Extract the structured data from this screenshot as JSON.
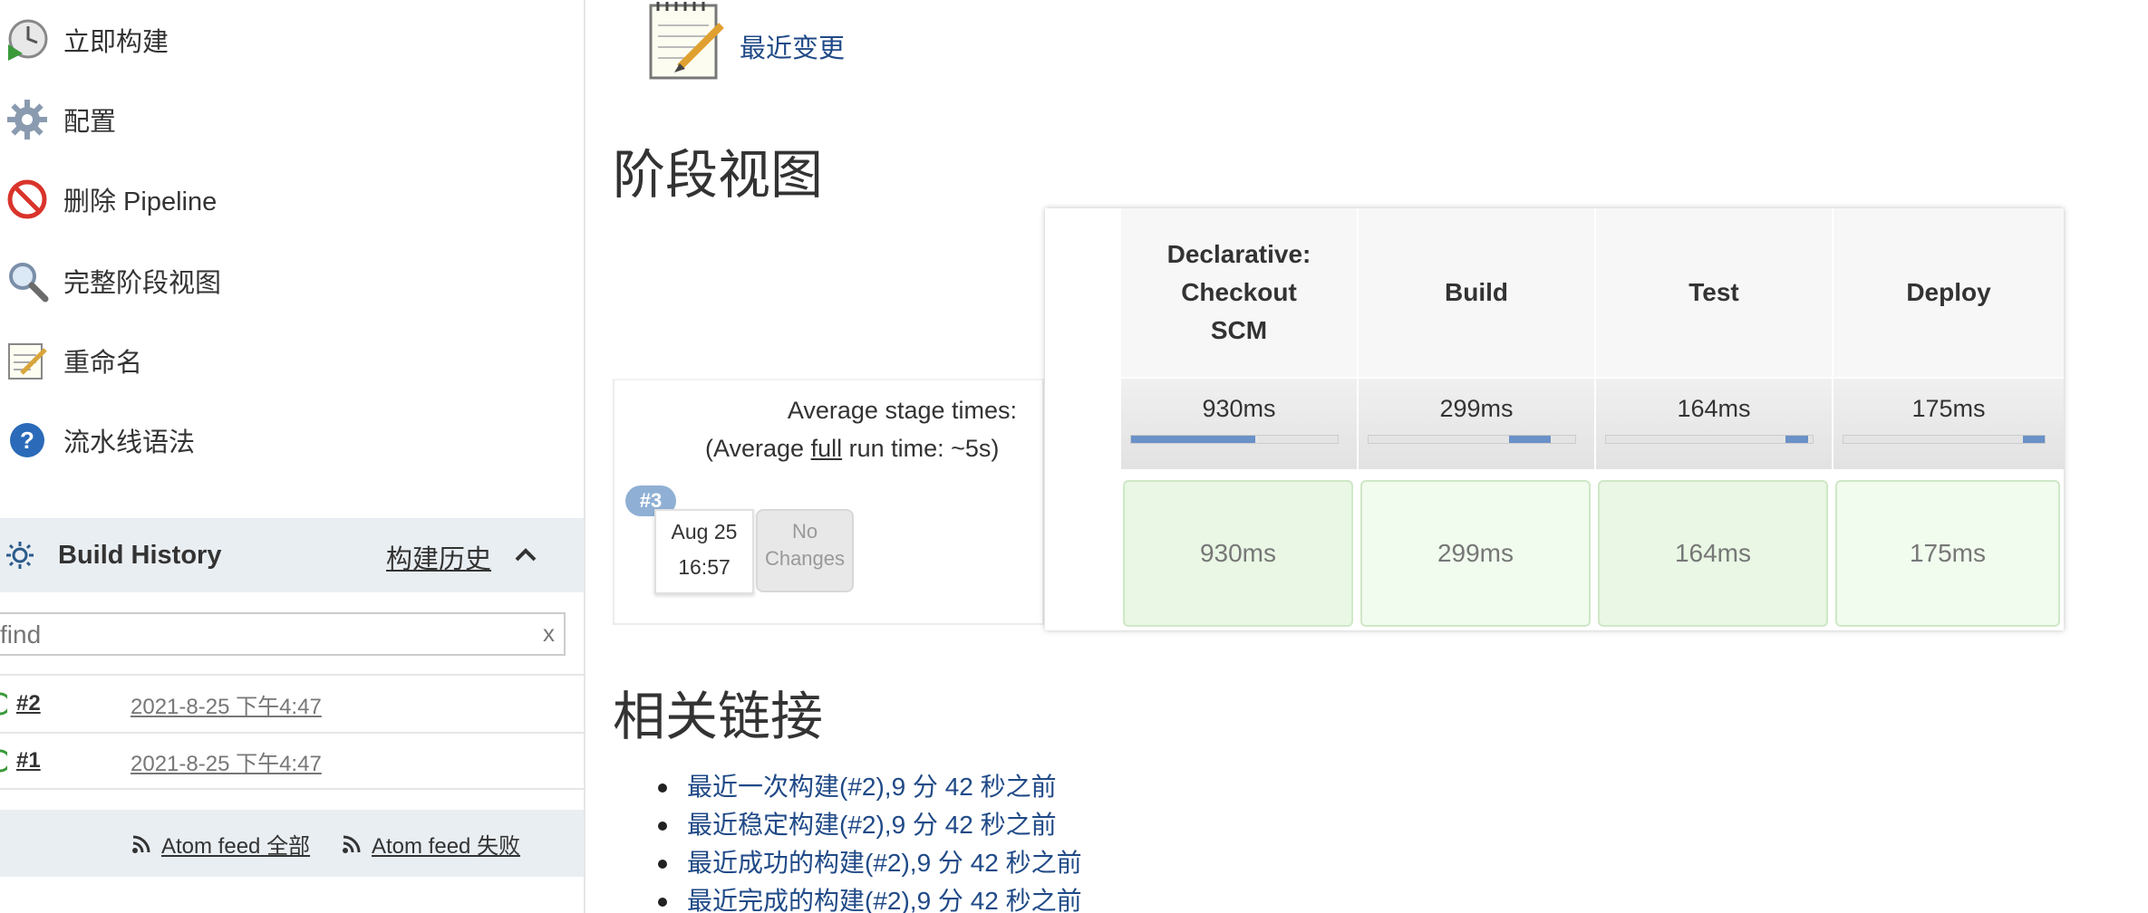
{
  "sidebar": {
    "tasks": [
      {
        "label": "立即构建",
        "icon": "clock-build-icon"
      },
      {
        "label": "配置",
        "icon": "gear-icon"
      },
      {
        "label": "删除 Pipeline",
        "icon": "no-entry-icon"
      },
      {
        "label": "完整阶段视图",
        "icon": "magnifier-icon"
      },
      {
        "label": "重命名",
        "icon": "notepad-icon"
      },
      {
        "label": "流水线语法",
        "icon": "help-icon"
      }
    ],
    "build_history": {
      "title": "Build History",
      "link": "构建历史",
      "search_placeholder": "find",
      "clear": "x",
      "builds": [
        {
          "number": "#2",
          "date": "2021-8-25 下午4:47"
        },
        {
          "number": "#1",
          "date": "2021-8-25 下午4:47"
        }
      ],
      "feeds": [
        "Atom feed 全部",
        "Atom feed 失败"
      ]
    }
  },
  "main": {
    "recent_changes": "最近变更",
    "stage_view_title": "阶段视图",
    "stage_view": {
      "avg_label": "Average stage times:",
      "avg_full_prefix": "(Average ",
      "avg_full_word": "full",
      "avg_full_suffix": " run time: ~5s)",
      "build": {
        "badge": "#3",
        "date": "Aug 25",
        "time": "16:57",
        "changes_line1": "No",
        "changes_line2": "Changes"
      },
      "stages": [
        {
          "name_lines": [
            "Declarative:",
            "Checkout",
            "SCM"
          ],
          "avg": "930ms",
          "cell": "930ms",
          "avg_fraction": 0.6
        },
        {
          "name_lines": [
            "Build"
          ],
          "avg": "299ms",
          "cell": "299ms",
          "avg_fraction": 0.2
        },
        {
          "name_lines": [
            "Test"
          ],
          "avg": "164ms",
          "cell": "164ms",
          "avg_fraction": 0.11
        },
        {
          "name_lines": [
            "Deploy"
          ],
          "avg": "175ms",
          "cell": "175ms",
          "avg_fraction": 0.11
        }
      ]
    },
    "related_links_title": "相关链接",
    "related_links": [
      "最近一次构建(#2),9 分 42 秒之前",
      "最近稳定构建(#2),9 分 42 秒之前",
      "最近成功的构建(#2),9 分 42 秒之前",
      "最近完成的构建(#2),9 分 42 秒之前"
    ]
  }
}
